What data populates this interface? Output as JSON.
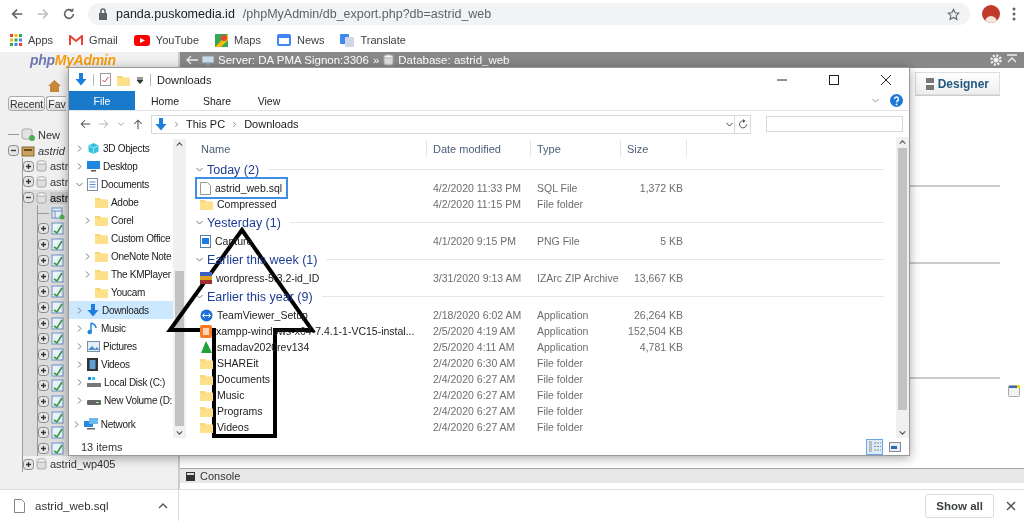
{
  "browser": {
    "url_host": "panda.puskomedia.id",
    "url_path": "/phpMyAdmin/db_export.php?db=astrid_web",
    "bookmarks": [
      {
        "label": "Apps",
        "kind": "apps"
      },
      {
        "label": "Gmail",
        "kind": "gmail"
      },
      {
        "label": "YouTube",
        "kind": "youtube"
      },
      {
        "label": "Maps",
        "kind": "maps"
      },
      {
        "label": "News",
        "kind": "news"
      },
      {
        "label": "Translate",
        "kind": "translate"
      }
    ]
  },
  "pma": {
    "logo": {
      "first": "php",
      "second": "MyAdmin"
    },
    "nav_buttons": [
      "Recent",
      "Fav"
    ],
    "tree": [
      {
        "label": "New",
        "kind": "new"
      },
      {
        "label": "astrid",
        "kind": "server",
        "expanded": true,
        "children": [
          {
            "label": "astr",
            "kind": "db",
            "expanded": false,
            "selected": false
          },
          {
            "label": "astr",
            "kind": "db",
            "expanded": false,
            "selected": false
          },
          {
            "label": "astr",
            "kind": "db",
            "expanded": true,
            "selected": true,
            "children": [
              {
                "kind": "new-table"
              },
              {
                "kind": "table",
                "expanded": false
              },
              {
                "kind": "table",
                "expanded": false
              },
              {
                "kind": "table",
                "expanded": false
              },
              {
                "kind": "table",
                "expanded": false
              },
              {
                "kind": "table",
                "expanded": false
              },
              {
                "kind": "table",
                "expanded": false
              },
              {
                "kind": "table",
                "expanded": false
              },
              {
                "kind": "table",
                "expanded": false
              },
              {
                "kind": "table",
                "expanded": false
              },
              {
                "kind": "table",
                "expanded": false
              },
              {
                "kind": "table",
                "expanded": false
              },
              {
                "kind": "table",
                "expanded": false
              },
              {
                "kind": "table",
                "expanded": false
              },
              {
                "kind": "table",
                "expanded": false
              },
              {
                "kind": "table",
                "expanded": false
              }
            ]
          },
          {
            "label": "astrid_wp405",
            "kind": "db",
            "expanded": false,
            "selected": false
          }
        ]
      }
    ],
    "breadcrumb": {
      "server": "Server: DA PMA Signon:3306",
      "separator": "»",
      "database": "Database: astrid_web"
    },
    "tabs": [
      {
        "label": "Designer"
      }
    ],
    "console": "Console"
  },
  "explorer": {
    "title": "Downloads",
    "ribbon_tabs": [
      {
        "label": "File",
        "kind": "file"
      },
      {
        "label": "Home",
        "kind": "tab"
      },
      {
        "label": "Share",
        "kind": "tab"
      },
      {
        "label": "View",
        "kind": "tab"
      }
    ],
    "address": [
      "This PC",
      "Downloads"
    ],
    "nav": [
      {
        "label": "3D Objects",
        "kind": "cube",
        "expanded": false,
        "selected": false
      },
      {
        "label": "Desktop",
        "kind": "desktop",
        "expanded": false,
        "selected": false
      },
      {
        "label": "Documents",
        "kind": "documents",
        "expanded": true,
        "selected": false,
        "children": [
          {
            "label": "Adobe",
            "kind": "folder",
            "selected": false
          },
          {
            "label": "Corel",
            "kind": "folder",
            "expanded": false,
            "selected": false
          },
          {
            "label": "Custom Office",
            "kind": "folder",
            "selected": false
          },
          {
            "label": "OneNote Note",
            "kind": "folder",
            "expanded": false,
            "selected": false
          },
          {
            "label": "The KMPlayer",
            "kind": "folder",
            "expanded": false,
            "selected": false
          },
          {
            "label": "Youcam",
            "kind": "folder",
            "selected": false
          }
        ]
      },
      {
        "label": "Downloads",
        "kind": "downloads",
        "expanded": false,
        "selected": true
      },
      {
        "label": "Music",
        "kind": "music",
        "expanded": false,
        "selected": false
      },
      {
        "label": "Pictures",
        "kind": "pictures",
        "expanded": false,
        "selected": false
      },
      {
        "label": "Videos",
        "kind": "videos",
        "expanded": false,
        "selected": false
      },
      {
        "label": "Local Disk (C:)",
        "kind": "disk",
        "expanded": false,
        "selected": false
      },
      {
        "label": "New Volume (D:",
        "kind": "drive",
        "expanded": false,
        "selected": false
      }
    ],
    "network": {
      "label": "Network",
      "expanded": false
    },
    "columns": [
      "Name",
      "Date modified",
      "Type",
      "Size"
    ],
    "groups": [
      {
        "label": "Today (2)",
        "expanded": true,
        "files": [
          {
            "name": "astrid_web.sql",
            "kind": "sql",
            "date": "4/2/2020 11:33 PM",
            "type": "SQL File",
            "size": "1,372 KB",
            "selected": true
          },
          {
            "name": "Compressed",
            "kind": "folder",
            "date": "4/2/2020 11:15 PM",
            "type": "File folder",
            "selected": false
          }
        ]
      },
      {
        "label": "Yesterday (1)",
        "expanded": true,
        "files": [
          {
            "name": "Capture",
            "kind": "png",
            "date": "4/1/2020 9:15 PM",
            "type": "PNG File",
            "size": "5 KB",
            "selected": false
          }
        ]
      },
      {
        "label": "Earlier this week (1)",
        "expanded": true,
        "files": [
          {
            "name": "wordpress-5.3.2-id_ID",
            "kind": "zip",
            "date": "3/31/2020 9:13 AM",
            "type": "IZArc ZIP Archive",
            "size": "13,667 KB",
            "selected": false
          }
        ]
      },
      {
        "label": "Earlier this year (9)",
        "expanded": true,
        "files": [
          {
            "name": "TeamViewer_Setup",
            "kind": "teamviewer",
            "date": "2/18/2020 6:02 AM",
            "type": "Application",
            "size": "26,264 KB",
            "selected": false
          },
          {
            "name": "xampp-windows-x64-7.4.1-1-VC15-instal...",
            "kind": "xampp",
            "date": "2/5/2020 4:19 AM",
            "type": "Application",
            "size": "152,504 KB",
            "selected": false
          },
          {
            "name": "smadav2020rev134",
            "kind": "smadav",
            "date": "2/5/2020 4:11 AM",
            "type": "Application",
            "size": "4,781 KB",
            "selected": false
          },
          {
            "name": "SHAREit",
            "kind": "folder",
            "date": "2/4/2020 6:30 AM",
            "type": "File folder",
            "selected": false
          },
          {
            "name": "Documents",
            "kind": "folder",
            "date": "2/4/2020 6:27 AM",
            "type": "File folder",
            "selected": false
          },
          {
            "name": "Music",
            "kind": "folder",
            "date": "2/4/2020 6:27 AM",
            "type": "File folder",
            "selected": false
          },
          {
            "name": "Programs",
            "kind": "folder",
            "date": "2/4/2020 6:27 AM",
            "type": "File folder",
            "selected": false
          },
          {
            "name": "Videos",
            "kind": "folder",
            "date": "2/4/2020 6:27 AM",
            "type": "File folder",
            "selected": false
          }
        ]
      }
    ],
    "status": "13 items",
    "views": [
      {
        "kind": "details",
        "selected": true
      },
      {
        "kind": "thumbnails",
        "selected": false
      }
    ]
  },
  "download_bar": {
    "file": "astrid_web.sql",
    "show_all": "Show all"
  }
}
